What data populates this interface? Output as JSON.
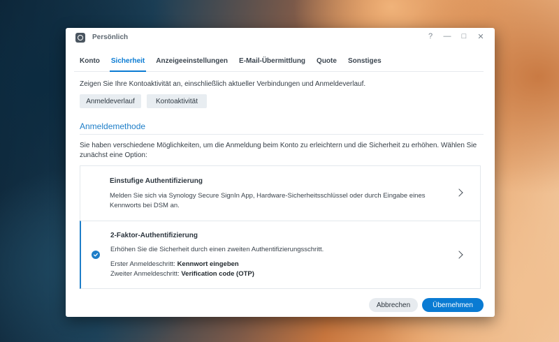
{
  "window": {
    "title": "Persönlich",
    "controls": [
      "?",
      "—",
      "□",
      "✕"
    ]
  },
  "tabs": [
    {
      "label": "Konto"
    },
    {
      "label": "Sicherheit",
      "active": true
    },
    {
      "label": "Anzeigeeinstellungen"
    },
    {
      "label": "E-Mail-Übermittlung"
    },
    {
      "label": "Quote"
    },
    {
      "label": "Sonstiges"
    }
  ],
  "activity": {
    "intro": "Zeigen Sie Ihre Kontoaktivität an, einschließlich aktueller Verbindungen und Anmeldeverlauf.",
    "login_history_label": "Anmeldeverlauf",
    "account_activity_label": "Kontoaktivität"
  },
  "method": {
    "title": "Anmeldemethode",
    "description": "Sie haben verschiedene Möglichkeiten, um die Anmeldung beim Konto zu erleichtern und die Sicherheit zu erhöhen. Wählen Sie zunächst eine Option:",
    "options": [
      {
        "title": "Einstufige Authentifizierung",
        "text": "Melden Sie sich via Synology Secure SignIn App, Hardware-Sicherheitsschlüssel oder durch Eingabe eines Kennworts bei DSM an.",
        "selected": false
      },
      {
        "title": "2-Faktor-Authentifizierung",
        "text": "Erhöhen Sie die Sicherheit durch einen zweiten Authentifizierungsschritt.",
        "step1_label": "Erster Anmeldeschritt:",
        "step1_value": "Kennwort eingeben",
        "step2_label": "Zweiter Anmeldeschritt:",
        "step2_value": "Verification code (OTP)",
        "selected": true
      }
    ]
  },
  "footer": {
    "cancel_label": "Abbrechen",
    "apply_label": "Übernehmen"
  },
  "colors": {
    "accent": "#0a7bd3",
    "section_title": "#1e7ec8"
  }
}
